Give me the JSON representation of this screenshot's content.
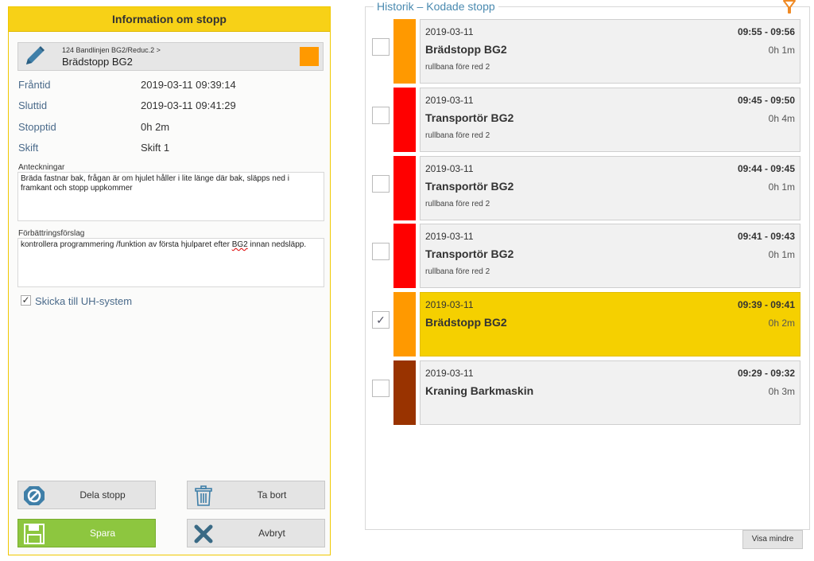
{
  "left": {
    "header": "Information om stopp",
    "stop_path": "124 Bandlinjen BG2/Reduc.2 >",
    "stop_name": "Brädstopp BG2",
    "stop_color": "#ff9900",
    "fields": [
      {
        "label": "Fråntid",
        "value": "2019-03-11 09:39:14"
      },
      {
        "label": "Sluttid",
        "value": "2019-03-11 09:41:29"
      },
      {
        "label": "Stopptid",
        "value": "0h 2m"
      },
      {
        "label": "Skift",
        "value": "Skift 1"
      }
    ],
    "notes_label": "Anteckningar",
    "notes_value": "Bräda fastnar bak, frågan är om hjulet håller i lite länge där bak, släpps ned i framkant och stopp uppkommer",
    "improvement_label": "Förbättringsförslag",
    "improvement_value_pre": "kontrollera programmering /funktion av första hjulparet efter ",
    "improvement_value_mark": "BG2",
    "improvement_value_post": " innan nedsläpp.",
    "send_label": "Skicka till UH-system",
    "send_checked": "✓",
    "buttons": {
      "split": "Dela stopp",
      "delete": "Ta bort",
      "save": "Spara",
      "cancel": "Avbryt"
    }
  },
  "history": {
    "title": "Historik – Kodade stopp",
    "show_less": "Visa mindre",
    "items": [
      {
        "date": "2019-03-11",
        "time": "09:55 - 09:56",
        "name": "Brädstopp BG2",
        "duration": "0h 1m",
        "sub": "rullbana före red 2",
        "color": "#ff9900",
        "checked": "",
        "selected": false
      },
      {
        "date": "2019-03-11",
        "time": "09:45 - 09:50",
        "name": "Transportör BG2",
        "duration": "0h 4m",
        "sub": "rullbana före red 2",
        "color": "#ff0000",
        "checked": "",
        "selected": false
      },
      {
        "date": "2019-03-11",
        "time": "09:44 - 09:45",
        "name": "Transportör BG2",
        "duration": "0h 1m",
        "sub": "rullbana före red 2",
        "color": "#ff0000",
        "checked": "",
        "selected": false
      },
      {
        "date": "2019-03-11",
        "time": "09:41 - 09:43",
        "name": "Transportör BG2",
        "duration": "0h 1m",
        "sub": "rullbana före red 2",
        "color": "#ff0000",
        "checked": "",
        "selected": false
      },
      {
        "date": "2019-03-11",
        "time": "09:39 - 09:41",
        "name": "Brädstopp BG2",
        "duration": "0h 2m",
        "sub": "",
        "color": "#ff9900",
        "checked": "✓",
        "selected": true
      },
      {
        "date": "2019-03-11",
        "time": "09:29 - 09:32",
        "name": "Kraning Barkmaskin",
        "duration": "0h 3m",
        "sub": "",
        "color": "#993300",
        "checked": "",
        "selected": false
      }
    ]
  },
  "icons": {
    "edit": "pencil-icon",
    "split": "split-icon",
    "delete": "trash-icon",
    "save": "floppy-icon",
    "cancel": "close-icon",
    "filter": "filter-icon"
  }
}
